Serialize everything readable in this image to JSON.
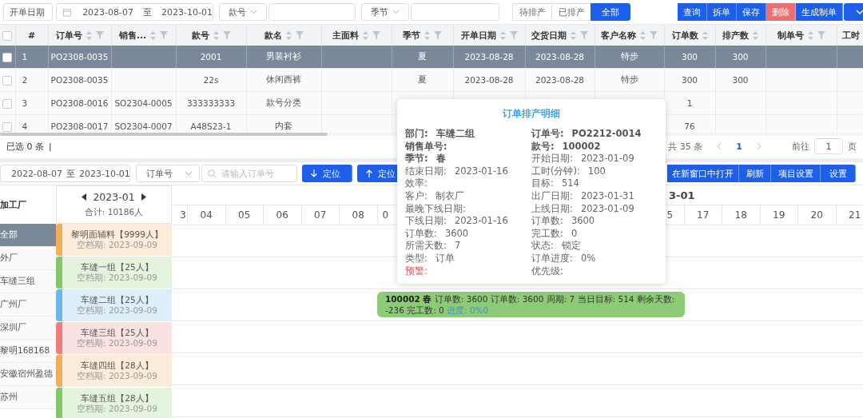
{
  "filter_bar": {
    "date_field": "开单日期",
    "date_from": "2023-08-07",
    "date_sep": "至",
    "date_to": "2023-10-01",
    "style_field": "款号",
    "season_field": "季节",
    "segments": [
      {
        "label": "待排产",
        "selected": false
      },
      {
        "label": "已排产",
        "selected": false
      },
      {
        "label": "全部",
        "selected": true
      }
    ],
    "buttons": [
      {
        "label": "查询",
        "kind": "primary"
      },
      {
        "label": "拆单",
        "kind": "primary"
      },
      {
        "label": "保存",
        "kind": "primary"
      },
      {
        "label": "删除",
        "kind": "danger"
      },
      {
        "label": "生成制单",
        "kind": "primary"
      }
    ]
  },
  "table": {
    "all_checked": false,
    "columns": [
      {
        "label": "#",
        "sortable": false,
        "filterable": false
      },
      {
        "label": "订单号",
        "sortable": true,
        "filterable": true
      },
      {
        "label": "销售...",
        "sortable": true,
        "filterable": true
      },
      {
        "label": "款号",
        "sortable": true,
        "filterable": true
      },
      {
        "label": "款名",
        "sortable": true,
        "filterable": true
      },
      {
        "label": "主面料",
        "sortable": true,
        "filterable": true
      },
      {
        "label": "季节",
        "sortable": true,
        "filterable": true
      },
      {
        "label": "开单日期",
        "sortable": true,
        "filterable": true
      },
      {
        "label": "交货日期",
        "sortable": true,
        "filterable": true
      },
      {
        "label": "客户名称",
        "sortable": true,
        "filterable": true
      },
      {
        "label": "订单数",
        "sortable": true,
        "filterable": false
      },
      {
        "label": "排产数",
        "sortable": true,
        "filterable": false
      },
      {
        "label": "制单号",
        "sortable": true,
        "filterable": true
      },
      {
        "label": "工时",
        "sortable": false,
        "filterable": false
      }
    ],
    "rows": [
      {
        "selected": true,
        "checked": false,
        "index": "1",
        "order_no": "PO2308-0035",
        "style_no": "2001",
        "style_name": "男装衬衫",
        "season": "夏",
        "open_date": "2023-08-28",
        "delivery_date": "2023-08-28",
        "customer": "特步",
        "order_qty": "300",
        "scheduled_qty": "300"
      },
      {
        "selected": false,
        "checked": false,
        "index": "2",
        "order_no": "PO2308-0035",
        "style_no": "22s",
        "style_name": "休闲西裤",
        "season": "夏",
        "open_date": "2023-08-28",
        "delivery_date": "2023-08-28",
        "customer": "特步",
        "order_qty": "300",
        "scheduled_qty": "300"
      },
      {
        "selected": false,
        "checked": false,
        "index": "3",
        "order_no": "PO2308-0016",
        "sales_no": "SO2304-0005",
        "style_no": "333333333",
        "style_name": "款号分类",
        "order_qty": "1"
      },
      {
        "selected": false,
        "checked": false,
        "index": "4",
        "order_no": "PO2308-0017",
        "sales_no": "SO2304-0007",
        "style_no": "A48S23-1",
        "style_name": "内套",
        "order_qty": "76"
      }
    ]
  },
  "footer": {
    "selected_count": "已选 0 条",
    "separator": "|",
    "total": "共 35 条",
    "current_page": "1",
    "goto_label": "前往",
    "goto_value": "1",
    "page_unit": "页"
  },
  "schedule_toolbar": {
    "date_from": "2022-08-07",
    "date_sep": "至",
    "date_to": "2023-10-01",
    "search_field": "订单号",
    "search_placeholder": "请输入订单号",
    "locate_buttons": [
      {
        "label": "定位",
        "kind": "down"
      },
      {
        "label": "定位",
        "kind": "up"
      }
    ],
    "right_buttons": [
      "在新窗口中打开",
      "刷新",
      "项目设置",
      "设置"
    ]
  },
  "gantt": {
    "factory_header": "加工厂",
    "factories": [
      {
        "label": "全部",
        "selected": true
      },
      {
        "label": "外厂",
        "selected": false
      },
      {
        "label": "车缝三组",
        "selected": false
      },
      {
        "label": "广州厂",
        "selected": false
      },
      {
        "label": "深圳厂",
        "selected": false
      },
      {
        "label": "黎明168168",
        "selected": false
      },
      {
        "label": "安徽宿州盈德",
        "selected": false
      },
      {
        "label": "苏州",
        "selected": false
      }
    ],
    "month": "2023-01",
    "total": "合计: 10186人",
    "month_title": "3-01",
    "days_before": [
      "3",
      "04",
      "05",
      "06",
      "07",
      "08",
      "0"
    ],
    "days_after": [
      "5",
      "17",
      "18",
      "19",
      "20",
      "21"
    ],
    "groups": [
      {
        "name": "黎明面辅料【9999人】",
        "idle": "空档期: 2023-09-09",
        "color": "#f0ad5a"
      },
      {
        "name": "车缝一组【25人】",
        "idle": "空档期: 2023-09-09",
        "color": "#84c86b"
      },
      {
        "name": "车缝二组【25人】",
        "idle": "空档期: 2023-09-09",
        "color": "#6bb8ea",
        "task": {
          "title": "100002 春",
          "text": "订单数: 3600 订单数: 3600 周期: 7 当日目标: 514 剩余天数: -236 完工数: 0",
          "progress_label": "进度:",
          "progress_value": "0%0"
        }
      },
      {
        "name": "车缝三组【25人】",
        "idle": "空档期: 2023-09-09",
        "color": "#ef7b7b"
      },
      {
        "name": "车缝四组【28人】",
        "idle": "空档期: 2023-09-09",
        "color": "#f0ad5a"
      },
      {
        "name": "车缝五组【28人】",
        "idle": "空档期: 2023-09-09",
        "color": "#84c86b"
      }
    ]
  },
  "detail_popup": {
    "title": "订单排产明细",
    "left": [
      {
        "label": "部门:",
        "value": "车缝二组",
        "kind": "strong"
      },
      {
        "label": "销售单号:",
        "kind": "strong"
      },
      {
        "label": "季节:",
        "value": "春",
        "kind": "strong"
      },
      {
        "label": "结束日期:",
        "value": "2023-01-16",
        "kind": "plain"
      },
      {
        "label": "效率:",
        "kind": "plain"
      },
      {
        "label": "客户:",
        "value": "制衣厂",
        "kind": "plain"
      },
      {
        "label": "最晚下线日期:",
        "kind": "plain"
      },
      {
        "label": "下线日期:",
        "value": "2023-01-16",
        "kind": "plain"
      },
      {
        "label": "订单数:",
        "value": "3600",
        "kind": "plain"
      },
      {
        "label": "所需天数:",
        "value": "7",
        "kind": "plain"
      },
      {
        "label": "类型:",
        "value": "订单",
        "kind": "plain"
      },
      {
        "label": "预警:",
        "kind": "alert"
      }
    ],
    "right": [
      {
        "label": "订单号:",
        "value": "PO2212-0014",
        "kind": "strong"
      },
      {
        "label": "款号:",
        "value": "100002",
        "kind": "strong"
      },
      {
        "label": "开始日期:",
        "value": "2023-01-09",
        "kind": "plain"
      },
      {
        "label": "工时(分钟):",
        "value": "100",
        "kind": "plain"
      },
      {
        "label": "目标:",
        "value": "514",
        "kind": "plain"
      },
      {
        "label": "出厂日期:",
        "value": "2023-01-31",
        "kind": "plain"
      },
      {
        "label": "上线日期:",
        "value": "2023-01-09",
        "kind": "plain"
      },
      {
        "label": "订单数:",
        "value": "3600",
        "kind": "plain"
      },
      {
        "label": "完工数:",
        "value": "0",
        "kind": "plain"
      },
      {
        "label": "状态:",
        "value": "锁定",
        "kind": "plain"
      },
      {
        "label": "订单进度:",
        "value": "0%",
        "kind": "plain"
      },
      {
        "label": "优先级:",
        "kind": "plain"
      }
    ]
  }
}
